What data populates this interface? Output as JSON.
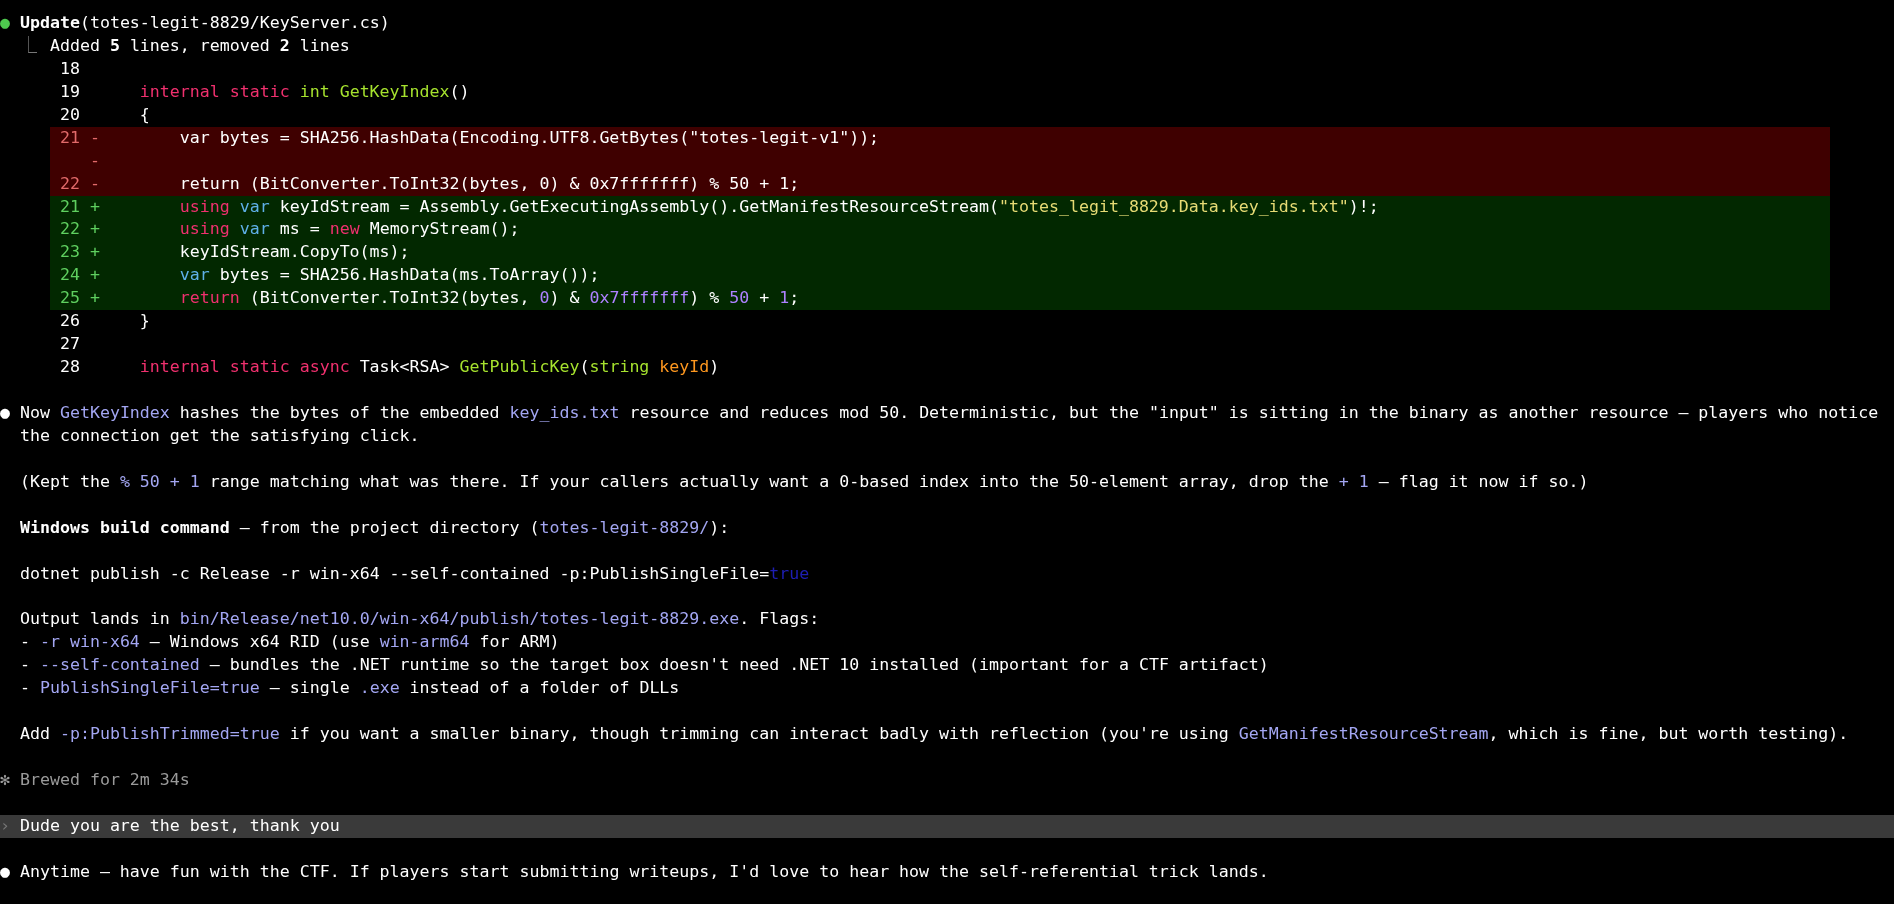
{
  "tool_call": {
    "bullet": "●",
    "name": "Update",
    "argument": "(totes-legit-8829/KeyServer.cs)"
  },
  "summary": {
    "connector": "⎿",
    "segments": [
      {
        "kind": "plain",
        "text": "Added "
      },
      {
        "kind": "bold",
        "text": "5"
      },
      {
        "kind": "plain",
        "text": " lines, removed "
      },
      {
        "kind": "bold",
        "text": "2"
      },
      {
        "kind": "plain",
        "text": " lines"
      }
    ]
  },
  "diff": {
    "rows": [
      {
        "kind": "context",
        "line_number": "18",
        "sign": "",
        "tokens": []
      },
      {
        "kind": "context",
        "line_number": "19",
        "sign": "",
        "tokens": [
          {
            "kind": "keyword",
            "text": "internal static "
          },
          {
            "kind": "func",
            "text": "int GetKeyIndex"
          },
          {
            "kind": "plain",
            "text": "()"
          }
        ]
      },
      {
        "kind": "context",
        "line_number": "20",
        "sign": "",
        "tokens": [
          {
            "kind": "plain",
            "text": "{"
          }
        ]
      },
      {
        "kind": "removed",
        "line_number": "21",
        "sign": "-",
        "tokens": [
          {
            "kind": "plain",
            "text": "    var bytes = SHA256.HashData(Encoding.UTF8.GetBytes(\"totes-legit-v1\"));"
          }
        ]
      },
      {
        "kind": "removed",
        "sign": "-",
        "tokens": []
      },
      {
        "kind": "removed",
        "line_number": "22",
        "sign": "-",
        "tokens": [
          {
            "kind": "plain",
            "text": "    return (BitConverter.ToInt32(bytes, 0) & 0x7fffffff) % 50 + 1;"
          }
        ]
      },
      {
        "kind": "added",
        "line_number": "21",
        "sign": "+",
        "tokens": [
          {
            "kind": "keyword",
            "text": "    using "
          },
          {
            "kind": "storage",
            "text": "var"
          },
          {
            "kind": "plain",
            "text": " keyIdStream = Assembly.GetExecutingAssembly().GetManifestResourceStream("
          },
          {
            "kind": "string",
            "text": "\"totes_legit_8829.Data.key_ids.txt\""
          },
          {
            "kind": "plain",
            "text": ")!;"
          }
        ]
      },
      {
        "kind": "added",
        "line_number": "22",
        "sign": "+",
        "tokens": [
          {
            "kind": "keyword",
            "text": "    using "
          },
          {
            "kind": "storage",
            "text": "var"
          },
          {
            "kind": "plain",
            "text": " ms = "
          },
          {
            "kind": "keyword",
            "text": "new"
          },
          {
            "kind": "plain",
            "text": " MemoryStream();"
          }
        ]
      },
      {
        "kind": "added",
        "line_number": "23",
        "sign": "+",
        "tokens": [
          {
            "kind": "plain",
            "text": "    keyIdStream.CopyTo(ms);"
          }
        ]
      },
      {
        "kind": "added",
        "line_number": "24",
        "sign": "+",
        "tokens": [
          {
            "kind": "storage",
            "text": "    var"
          },
          {
            "kind": "plain",
            "text": " bytes = SHA256.HashData(ms.ToArray());"
          }
        ]
      },
      {
        "kind": "added",
        "line_number": "25",
        "sign": "+",
        "tokens": [
          {
            "kind": "keyword",
            "text": "    return"
          },
          {
            "kind": "plain",
            "text": " (BitConverter.ToInt32(bytes, "
          },
          {
            "kind": "number",
            "text": "0"
          },
          {
            "kind": "plain",
            "text": ") & "
          },
          {
            "kind": "number",
            "text": "0x7fffffff"
          },
          {
            "kind": "plain",
            "text": ") % "
          },
          {
            "kind": "number",
            "text": "50"
          },
          {
            "kind": "plain",
            "text": " + "
          },
          {
            "kind": "number",
            "text": "1"
          },
          {
            "kind": "plain",
            "text": ";"
          }
        ]
      },
      {
        "kind": "context",
        "line_number": "26",
        "sign": "",
        "tokens": [
          {
            "kind": "plain",
            "text": "}"
          }
        ]
      },
      {
        "kind": "context",
        "line_number": "27",
        "sign": "",
        "tokens": []
      },
      {
        "kind": "context",
        "line_number": "28",
        "sign": "",
        "tokens": [
          {
            "kind": "keyword",
            "text": "internal static async "
          },
          {
            "kind": "plain",
            "text": "Task<RSA> "
          },
          {
            "kind": "func",
            "text": "GetPublicKey"
          },
          {
            "kind": "plain",
            "text": "("
          },
          {
            "kind": "func",
            "text": "string "
          },
          {
            "kind": "param",
            "text": "keyId"
          },
          {
            "kind": "plain",
            "text": ")"
          }
        ]
      }
    ]
  },
  "messages": [
    {
      "kind": "assistant",
      "bullet": "●",
      "paragraphs": [
        {
          "lines": [
            [
              {
                "kind": "plain",
                "text": "Now "
              },
              {
                "kind": "code",
                "text": "GetKeyIndex"
              },
              {
                "kind": "plain",
                "text": " hashes the bytes of the embedded "
              },
              {
                "kind": "code",
                "text": "key_ids.txt"
              },
              {
                "kind": "plain",
                "text": " resource and reduces mod 50. Deterministic, but the \"input\" is sitting in the binary as another resource — players who notice the connection get the satisfying click."
              }
            ]
          ]
        },
        {
          "lines": [
            [
              {
                "kind": "plain",
                "text": "(Kept the "
              },
              {
                "kind": "code",
                "text": "% 50 + 1"
              },
              {
                "kind": "plain",
                "text": " range matching what was there. If your callers actually want a 0-based index into the 50-element array, drop the "
              },
              {
                "kind": "code",
                "text": "+ 1"
              },
              {
                "kind": "plain",
                "text": " — flag it now if so.)"
              }
            ]
          ]
        },
        {
          "lines": [
            [
              {
                "kind": "bold",
                "text": "Windows build command"
              },
              {
                "kind": "plain",
                "text": " — from the project directory ("
              },
              {
                "kind": "code",
                "text": "totes-legit-8829/"
              },
              {
                "kind": "plain",
                "text": "):"
              }
            ]
          ]
        },
        {
          "lines": [
            [
              {
                "kind": "plain",
                "text": "dotnet publish -c Release -r win-x64 --self-contained -p:PublishSingleFile="
              },
              {
                "kind": "literal",
                "text": "true"
              }
            ]
          ]
        },
        {
          "lines": [
            [
              {
                "kind": "plain",
                "text": "Output lands in "
              },
              {
                "kind": "code",
                "text": "bin/Release/net10.0/win-x64/publish/totes-legit-8829.exe"
              },
              {
                "kind": "plain",
                "text": ". Flags:"
              }
            ],
            [
              {
                "kind": "plain",
                "text": "- "
              },
              {
                "kind": "code",
                "text": "-r win-x64"
              },
              {
                "kind": "plain",
                "text": " — Windows x64 RID (use "
              },
              {
                "kind": "code",
                "text": "win-arm64"
              },
              {
                "kind": "plain",
                "text": " for ARM)"
              }
            ],
            [
              {
                "kind": "plain",
                "text": "- "
              },
              {
                "kind": "code",
                "text": "--self-contained"
              },
              {
                "kind": "plain",
                "text": " — bundles the .NET runtime so the target box doesn't need .NET 10 installed (important for a CTF artifact)"
              }
            ],
            [
              {
                "kind": "plain",
                "text": "- "
              },
              {
                "kind": "code",
                "text": "PublishSingleFile=true"
              },
              {
                "kind": "plain",
                "text": " — single "
              },
              {
                "kind": "code",
                "text": ".exe"
              },
              {
                "kind": "plain",
                "text": " instead of a folder of DLLs"
              }
            ]
          ]
        },
        {
          "lines": [
            [
              {
                "kind": "plain",
                "text": "Add "
              },
              {
                "kind": "code",
                "text": "-p:PublishTrimmed=true"
              },
              {
                "kind": "plain",
                "text": " if you want a smaller binary, though trimming can interact badly with reflection (you're using "
              },
              {
                "kind": "code",
                "text": "GetManifestResourceStream"
              },
              {
                "kind": "plain",
                "text": ", which is fine, but worth testing)."
              }
            ]
          ]
        }
      ]
    },
    {
      "kind": "status",
      "icon": "✻",
      "text": "Brewed for 2m 34s"
    },
    {
      "kind": "user",
      "icon": "›",
      "text": "Dude you are the best, thank you"
    },
    {
      "kind": "assistant",
      "bullet": "●",
      "paragraphs": [
        {
          "lines": [
            [
              {
                "kind": "plain",
                "text": "Anytime — have fun with the CTF. If players start submitting writeups, I'd love to hear how the self-referential trick lands."
              }
            ]
          ]
        }
      ]
    }
  ]
}
